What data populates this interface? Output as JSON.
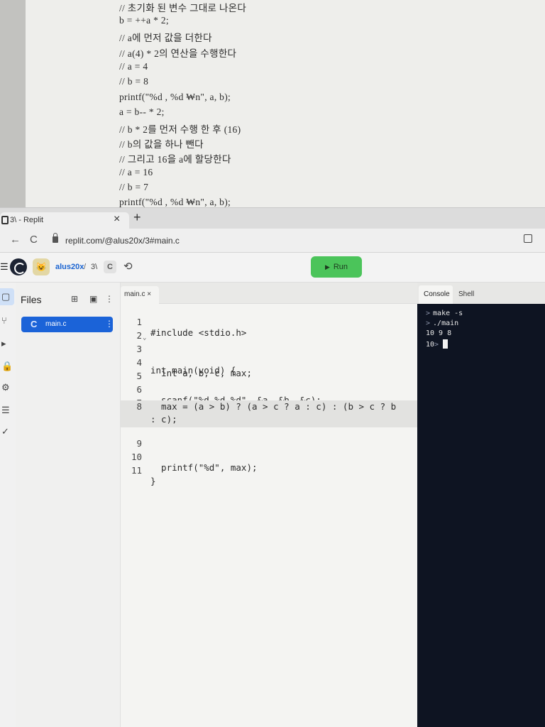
{
  "document": {
    "lines": [
      "// 초기화 된 변수 그대로 나온다",
      "b = ++a * 2;",
      "// a에 먼저 값을 더한다",
      "// a(4) * 2의 연산을 수행한다",
      "// a = 4",
      "// b = 8",
      "printf(\"%d , %d ₩n\", a, b);",
      "a = b-- * 2;",
      "// b * 2를 먼저 수행 한 후 (16)",
      "// b의 값을 하나 뺀다",
      "// 그리고 16을 a에 할당한다",
      "// a = 16",
      "// b = 7",
      "printf(\"%d , %d ₩n\", a, b);"
    ]
  },
  "browser": {
    "tab_title": "3\\ - Replit",
    "tab_close": "×",
    "new_tab": "+",
    "url": "replit.com/@alus20x/3#main.c",
    "back": "←",
    "forward": "→",
    "reload": "C"
  },
  "replit_header": {
    "username": "alus20x",
    "separator": "/",
    "repl_name": "3\\",
    "lang_badge": "C",
    "run_label": "Run"
  },
  "files_panel": {
    "title": "Files",
    "files": [
      {
        "name": "main.c"
      }
    ]
  },
  "editor": {
    "tab_label": "main.c ×",
    "lines": [
      {
        "n": "1",
        "text": "#include <stdio.h>"
      },
      {
        "n": "2",
        "text": ""
      },
      {
        "n": "3",
        "text": "int main(void) {"
      },
      {
        "n": "4",
        "text": "  int a, b, c, max;"
      },
      {
        "n": "5",
        "text": ""
      },
      {
        "n": "6",
        "text": "  scanf(\"%d %d %d\", &a, &b, &c);"
      },
      {
        "n": "7",
        "text": ""
      },
      {
        "n": "8",
        "text": "  max = (a > b) ? (a > c ? a : c) : (b > c ? b"
      },
      {
        "n": "",
        "text": ": c);"
      },
      {
        "n": "9",
        "text": ""
      },
      {
        "n": "10",
        "text": "  printf(\"%d\", max);"
      },
      {
        "n": "11",
        "text": "}"
      }
    ]
  },
  "console": {
    "tab_console": "Console",
    "tab_shell": "Shell",
    "prompt": ">",
    "cmd1": "make -s",
    "cmd2": "./main",
    "output1": "10 9 8",
    "output2": "10"
  },
  "colors": {
    "run_button": "#4bc45a",
    "file_selected": "#1b63d8",
    "console_bg": "#0e1422"
  }
}
